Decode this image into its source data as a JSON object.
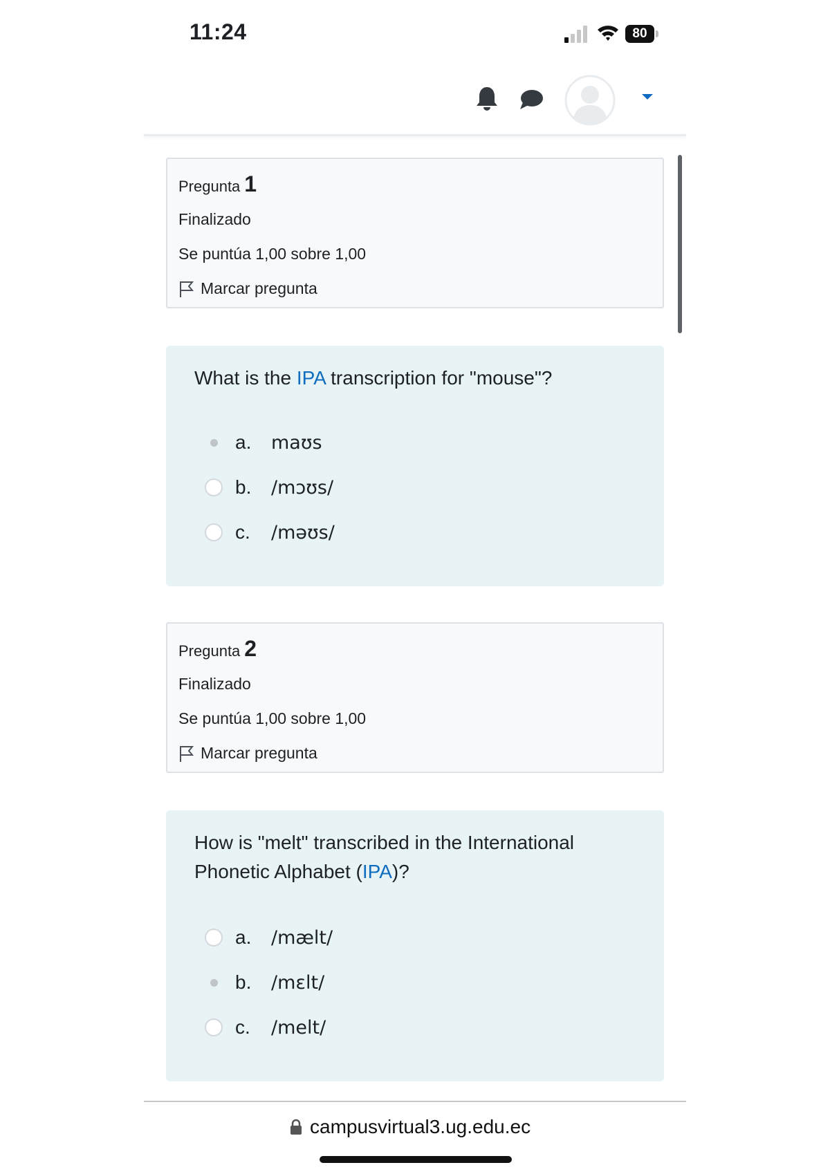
{
  "status_bar": {
    "time": "11:24",
    "battery": "80"
  },
  "header": {
    "icons": [
      "bell-icon",
      "chat-icon",
      "avatar",
      "caret-down-icon"
    ]
  },
  "questions": [
    {
      "info": {
        "label": "Pregunta",
        "number": "1",
        "state": "Finalizado",
        "grade": "Se puntúa 1,00 sobre 1,00",
        "flag": "Marcar pregunta"
      },
      "text_before": "What is the ",
      "link": "IPA",
      "text_after": " transcription for \"mouse\"?",
      "answers": [
        {
          "letter": "a.",
          "text": "maʊs",
          "checked": true
        },
        {
          "letter": "b.",
          "text": "/mɔʊs/",
          "checked": false
        },
        {
          "letter": "c.",
          "text": "/məʊs/",
          "checked": false
        }
      ]
    },
    {
      "info": {
        "label": "Pregunta",
        "number": "2",
        "state": "Finalizado",
        "grade": "Se puntúa 1,00 sobre 1,00",
        "flag": "Marcar pregunta"
      },
      "text_before": "How is \"melt\" transcribed in the International Phonetic Alphabet (",
      "link": "IPA",
      "text_after": ")?",
      "answers": [
        {
          "letter": "a.",
          "text": "/mælt/",
          "checked": false
        },
        {
          "letter": "b.",
          "text": "/mɛlt/",
          "checked": true
        },
        {
          "letter": "c.",
          "text": "/melt/",
          "checked": false
        }
      ]
    }
  ],
  "footer": {
    "url": "campusvirtual3.ug.edu.ec"
  },
  "colors": {
    "link": "#0f6cbf",
    "formulation_bg": "#e7f3f5",
    "info_bg": "#f8f9fa"
  }
}
